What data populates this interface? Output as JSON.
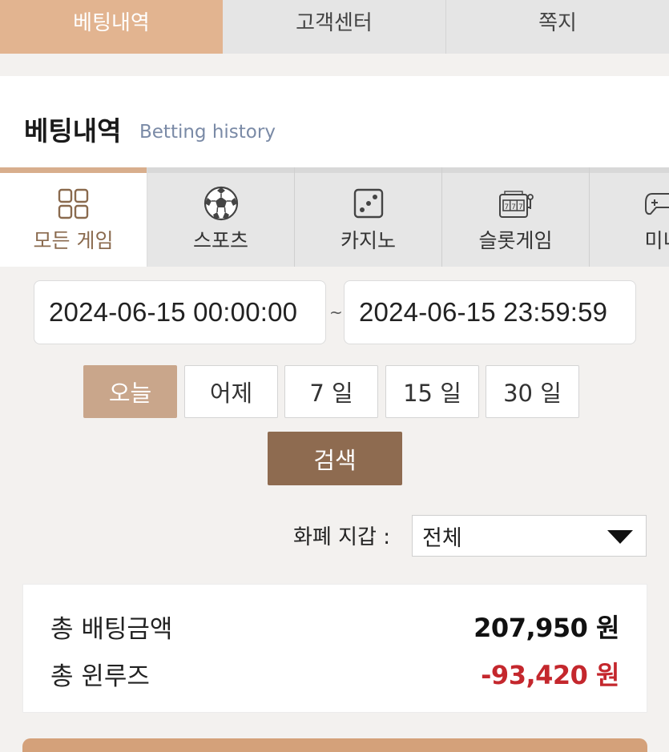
{
  "top_tabs": [
    {
      "label": "베팅내역"
    },
    {
      "label": "고객센터"
    },
    {
      "label": "쪽지"
    }
  ],
  "header": {
    "title": "베팅내역",
    "subtitle": "Betting history"
  },
  "categories": [
    {
      "label": "모든 게임",
      "icon": "grid-icon"
    },
    {
      "label": "스포츠",
      "icon": "soccer-ball-icon"
    },
    {
      "label": "카지노",
      "icon": "dice-icon"
    },
    {
      "label": "슬롯게임",
      "icon": "slot-machine-icon"
    },
    {
      "label": "미니",
      "icon": "gamepad-icon"
    }
  ],
  "date_range": {
    "from": "2024-06-15 00:00:00",
    "separator": "~",
    "to": "2024-06-15 23:59:59"
  },
  "periods": [
    {
      "label": "오늘"
    },
    {
      "label": "어제"
    },
    {
      "label": "7 일"
    },
    {
      "label": "15 일"
    },
    {
      "label": "30 일"
    }
  ],
  "search_label": "검색",
  "wallet": {
    "label": "화폐 지갑 :",
    "selected": "전체"
  },
  "summary": {
    "total_bet_label": "총 배팅금액",
    "total_bet_value": "207,950 원",
    "total_winloss_label": "총 윈루즈",
    "total_winloss_value": "-93,420 원"
  },
  "colors": {
    "accent": "#e2b490",
    "active_period": "#c9a68b",
    "search_button": "#8e6b50",
    "negative": "#c4272d"
  }
}
